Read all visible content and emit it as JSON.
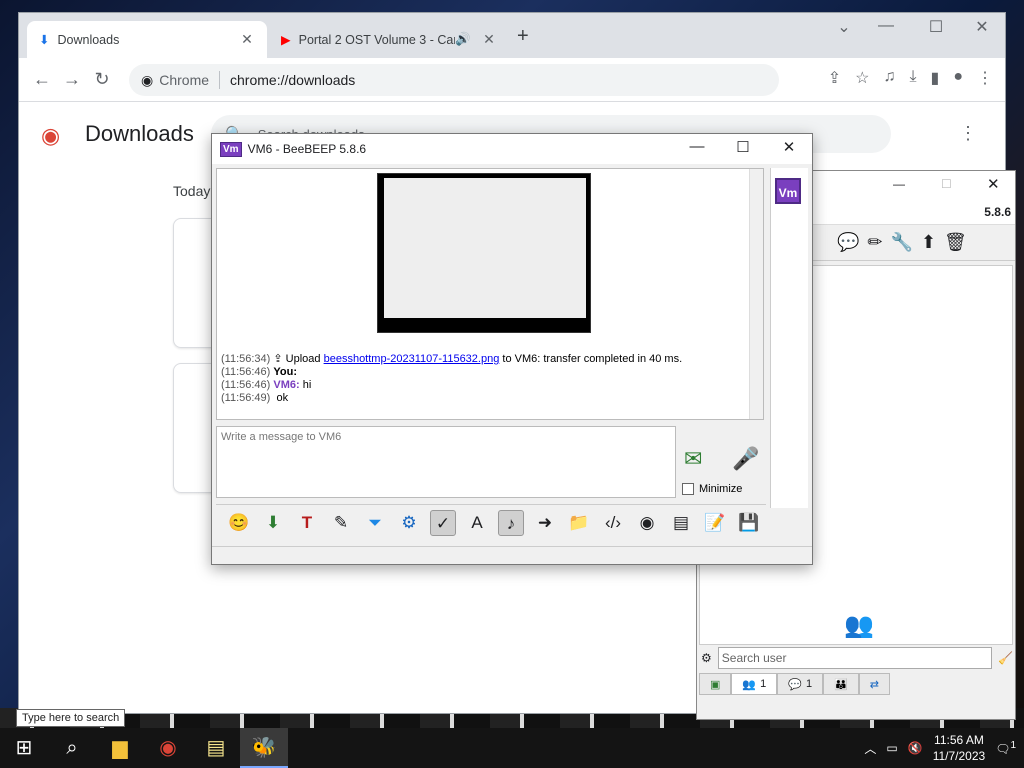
{
  "chrome": {
    "tabs": [
      {
        "title": "Downloads",
        "icon": "download-icon"
      },
      {
        "title": "Portal 2 OST Volume 3 - Car",
        "icon": "youtube-icon"
      }
    ],
    "omnibox_label": "Chrome",
    "url": "chrome://downloads",
    "page_title": "Downloads",
    "search_placeholder": "Search downloads",
    "section_today": "Today"
  },
  "beebeep_main": {
    "version": "5.8.6",
    "search_placeholder": "Search user",
    "tabs": [
      {
        "icon": "users-icon",
        "count": "1"
      },
      {
        "icon": "chat-icon",
        "count": "1"
      },
      {
        "icon": "groups-icon",
        "count": ""
      },
      {
        "icon": "share-icon",
        "count": ""
      }
    ]
  },
  "chat": {
    "badge": "Vm",
    "title": "VM6 - BeeBEEP 5.8.6",
    "messages": [
      {
        "time": "(11:56:34)",
        "pre": "Upload ",
        "link": "beesshottmp-20231107-115632.png",
        "post": " to VM6: transfer completed in 40 ms."
      },
      {
        "time": "(11:56:46)",
        "sender": "You:",
        "text": ""
      },
      {
        "time": "(11:56:46)",
        "sender": "VM6:",
        "text": "hi"
      },
      {
        "time": "(11:56:49)",
        "text": "ok"
      }
    ],
    "compose_placeholder": "Write a message to VM6",
    "minimize_label": "Minimize"
  },
  "taskbar": {
    "search_hint": "Type here to search",
    "time": "11:56 AM",
    "date": "11/7/2023",
    "notifications": "1"
  }
}
